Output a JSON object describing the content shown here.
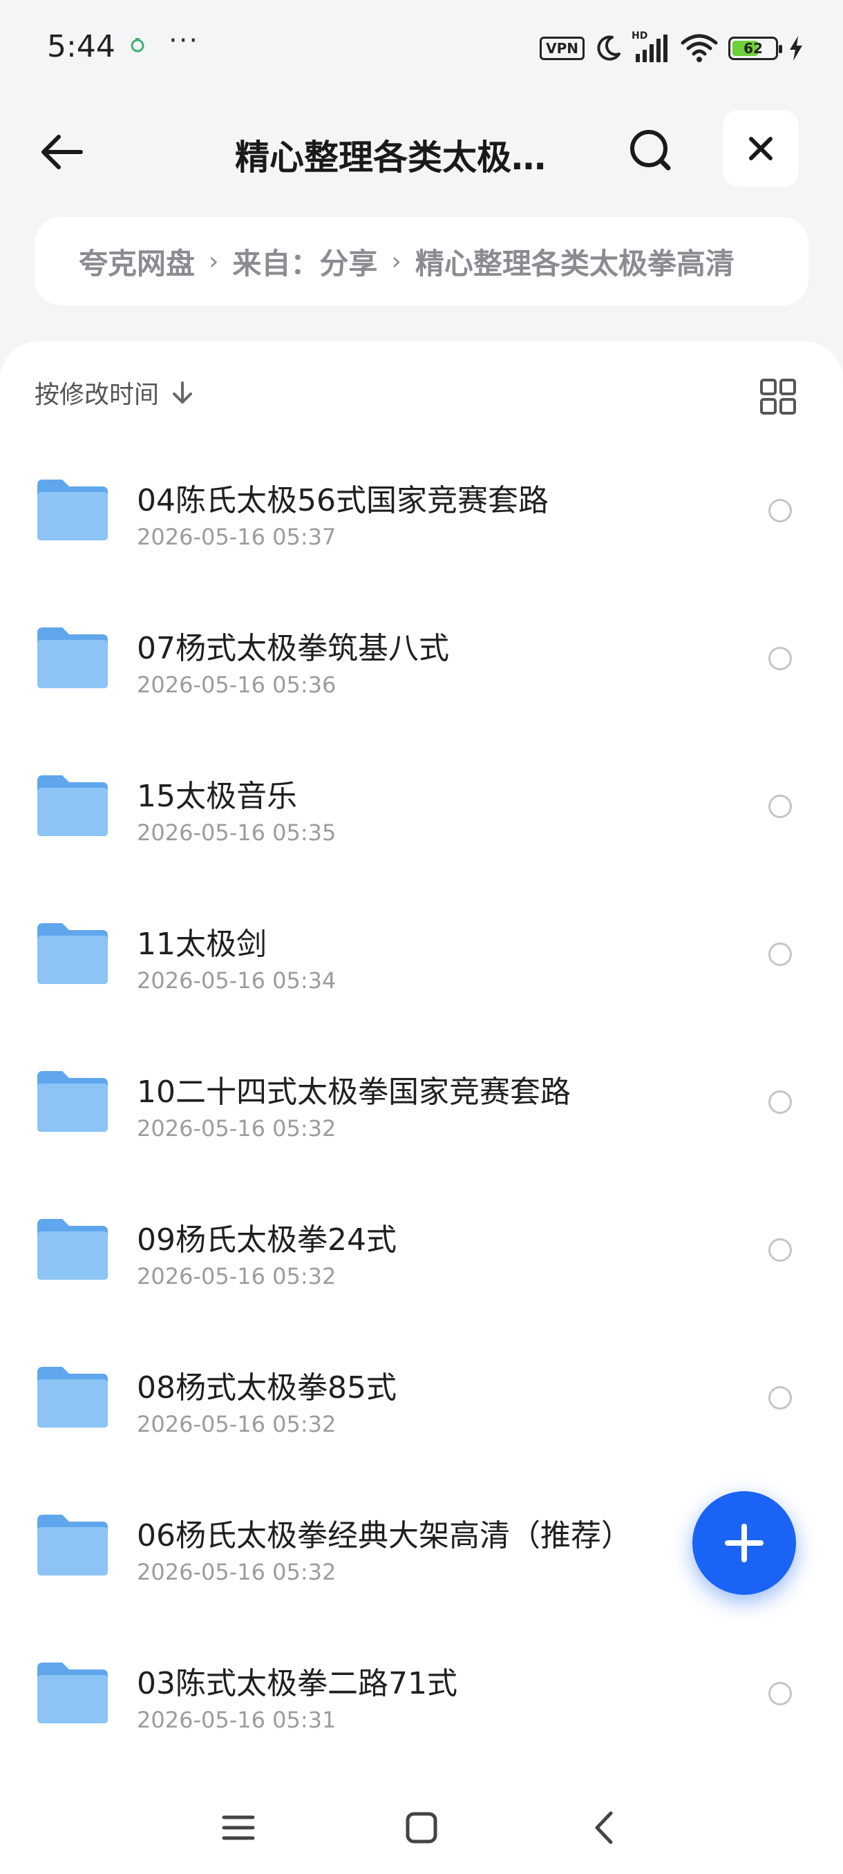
{
  "status_bar": {
    "time": "5:44",
    "more": "···",
    "vpn": "VPN",
    "hd": "HD",
    "battery": "62",
    "battery_level_percent": 62
  },
  "header": {
    "title": "精心整理各类太极…"
  },
  "breadcrumb": {
    "items": [
      "夸克网盘",
      "来自：分享",
      "精心整理各类太极拳高清"
    ],
    "separator": "›"
  },
  "toolbar": {
    "sort_label": "按修改时间"
  },
  "files": [
    {
      "name": "04陈氏太极56式国家竞赛套路",
      "date": "2026-05-16 05:37"
    },
    {
      "name": "07杨式太极拳筑基八式",
      "date": "2026-05-16 05:36"
    },
    {
      "name": "15太极音乐",
      "date": "2026-05-16 05:35"
    },
    {
      "name": "11太极剑",
      "date": "2026-05-16 05:34"
    },
    {
      "name": "10二十四式太极拳国家竞赛套路",
      "date": "2026-05-16 05:32"
    },
    {
      "name": "09杨氏太极拳24式",
      "date": "2026-05-16 05:32"
    },
    {
      "name": "08杨式太极拳85式",
      "date": "2026-05-16 05:32"
    },
    {
      "name": "06杨氏太极拳经典大架高清（推荐）",
      "date": "2026-05-16 05:32"
    },
    {
      "name": "03陈式太极拳二路71式",
      "date": "2026-05-16 05:31"
    }
  ],
  "icons": {
    "back": "arrow-left-icon",
    "search": "search-icon",
    "close": "close-icon",
    "sort": "arrow-down-icon",
    "view": "grid-view-icon",
    "folder": "folder-icon",
    "add": "plus-icon",
    "menu": "menu-icon",
    "home": "home-square-icon",
    "nav_back": "chevron-left-icon"
  },
  "colors": {
    "accent": "#1a63f5",
    "folder": "#6aaef0",
    "background": "#f4f5f7"
  }
}
